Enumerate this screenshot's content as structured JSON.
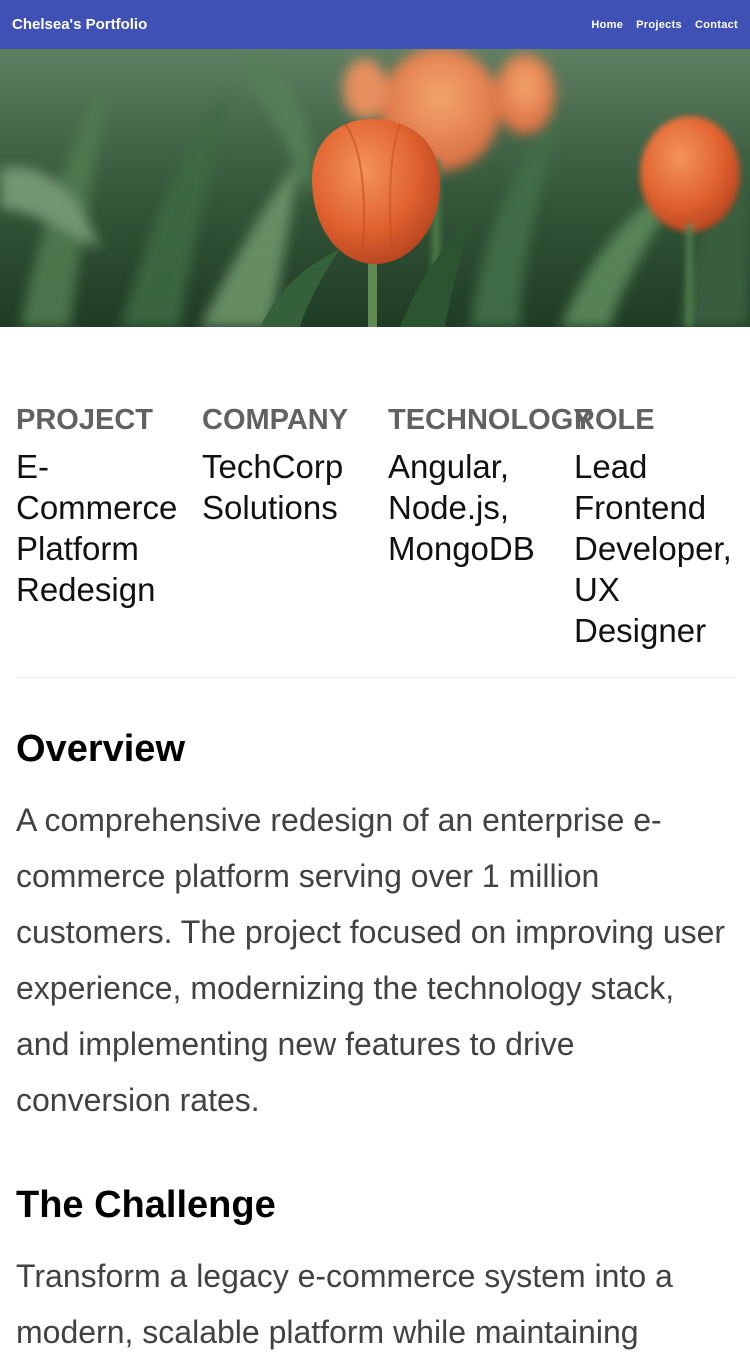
{
  "nav": {
    "brand": "Chelsea's Portfolio",
    "links": [
      "Home",
      "Projects",
      "Contact"
    ]
  },
  "hero": {
    "image_icon": "tulip-photo",
    "colors": {
      "foliage": "#2f5a35",
      "petal": "#e8643a"
    }
  },
  "meta": [
    {
      "label": "PROJECT",
      "value": "E-Commerce Platform Redesign"
    },
    {
      "label": "COMPANY",
      "value": "TechCorp Solutions"
    },
    {
      "label": "TECHNOLOGY",
      "value": "Angular, Node.js, MongoDB"
    },
    {
      "label": "ROLE",
      "value": "Lead Frontend Developer, UX Designer"
    }
  ],
  "overview": {
    "title": "Overview",
    "text": "A comprehensive redesign of an enterprise e-commerce platform serving over 1 million customers. The project focused on improving user experience, modernizing the technology stack, and implementing new features to drive conversion rates."
  },
  "challenge": {
    "title": "The Challenge",
    "text": "Transform a legacy e-commerce system into a modern, scalable platform while maintaining"
  },
  "theme": {
    "navbar": "#3f51b5",
    "label": "#616161"
  }
}
